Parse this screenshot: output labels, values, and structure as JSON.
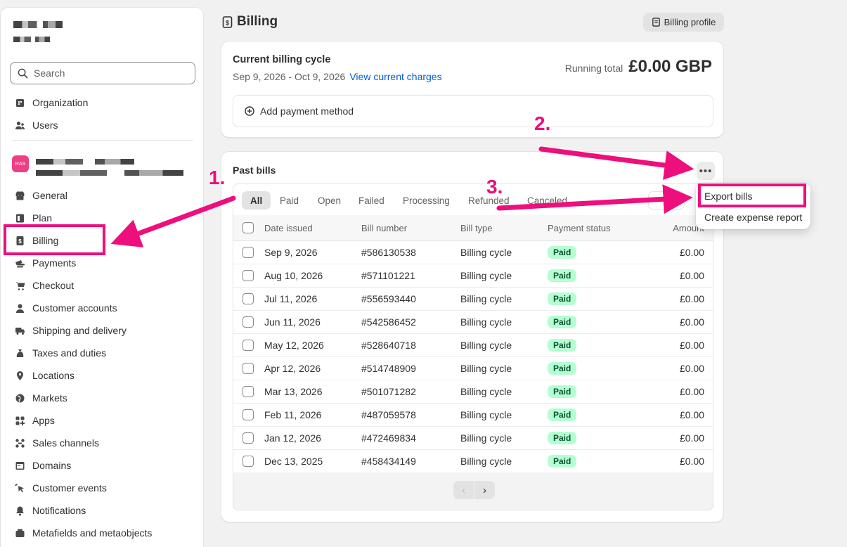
{
  "sidebar": {
    "search_placeholder": "Search",
    "top_items": [
      {
        "label": "Organization",
        "icon": "organization-icon"
      },
      {
        "label": "Users",
        "icon": "users-icon"
      }
    ],
    "account_badge": "RAS",
    "items": [
      {
        "label": "General",
        "icon": "store-icon"
      },
      {
        "label": "Plan",
        "icon": "plan-icon"
      },
      {
        "label": "Billing",
        "icon": "billing-icon"
      },
      {
        "label": "Payments",
        "icon": "payments-icon"
      },
      {
        "label": "Checkout",
        "icon": "cart-icon"
      },
      {
        "label": "Customer accounts",
        "icon": "person-icon"
      },
      {
        "label": "Shipping and delivery",
        "icon": "truck-icon"
      },
      {
        "label": "Taxes and duties",
        "icon": "money-bag-icon"
      },
      {
        "label": "Locations",
        "icon": "location-icon"
      },
      {
        "label": "Markets",
        "icon": "globe-icon"
      },
      {
        "label": "Apps",
        "icon": "apps-icon"
      },
      {
        "label": "Sales channels",
        "icon": "channels-icon"
      },
      {
        "label": "Domains",
        "icon": "domain-icon"
      },
      {
        "label": "Customer events",
        "icon": "cursor-icon"
      },
      {
        "label": "Notifications",
        "icon": "bell-icon"
      },
      {
        "label": "Metafields and metaobjects",
        "icon": "metafields-icon"
      }
    ]
  },
  "header": {
    "title": "Billing",
    "profile_button": "Billing profile"
  },
  "cycle": {
    "title": "Current billing cycle",
    "dates": "Sep 9, 2026 - Oct 9, 2026",
    "link": "View current charges",
    "running_label": "Running total",
    "running_amount": "£0.00 GBP",
    "add_payment": "Add payment method"
  },
  "past_bills": {
    "title": "Past bills",
    "more": "•••",
    "tabs": [
      "All",
      "Paid",
      "Open",
      "Failed",
      "Processing",
      "Refunded",
      "Canceled"
    ],
    "columns": [
      "Date issued",
      "Bill number",
      "Bill type",
      "Payment status",
      "Amount"
    ],
    "rows": [
      {
        "date": "Sep 9, 2026",
        "number": "#586130538",
        "type": "Billing cycle",
        "status": "Paid",
        "amount": "£0.00"
      },
      {
        "date": "Aug 10, 2026",
        "number": "#571101221",
        "type": "Billing cycle",
        "status": "Paid",
        "amount": "£0.00"
      },
      {
        "date": "Jul 11, 2026",
        "number": "#556593440",
        "type": "Billing cycle",
        "status": "Paid",
        "amount": "£0.00"
      },
      {
        "date": "Jun 11, 2026",
        "number": "#542586452",
        "type": "Billing cycle",
        "status": "Paid",
        "amount": "£0.00"
      },
      {
        "date": "May 12, 2026",
        "number": "#528640718",
        "type": "Billing cycle",
        "status": "Paid",
        "amount": "£0.00"
      },
      {
        "date": "Apr 12, 2026",
        "number": "#514748909",
        "type": "Billing cycle",
        "status": "Paid",
        "amount": "£0.00"
      },
      {
        "date": "Mar 13, 2026",
        "number": "#501071282",
        "type": "Billing cycle",
        "status": "Paid",
        "amount": "£0.00"
      },
      {
        "date": "Feb 11, 2026",
        "number": "#487059578",
        "type": "Billing cycle",
        "status": "Paid",
        "amount": "£0.00"
      },
      {
        "date": "Jan 12, 2026",
        "number": "#472469834",
        "type": "Billing cycle",
        "status": "Paid",
        "amount": "£0.00"
      },
      {
        "date": "Dec 13, 2025",
        "number": "#458434149",
        "type": "Billing cycle",
        "status": "Paid",
        "amount": "£0.00"
      }
    ],
    "pager_prev": "‹",
    "pager_next": "›"
  },
  "popover": {
    "export": "Export bills",
    "expense": "Create expense report"
  },
  "annotations": {
    "step1": "1.",
    "step2": "2.",
    "step3": "3.",
    "color": "#ee0e7c"
  }
}
